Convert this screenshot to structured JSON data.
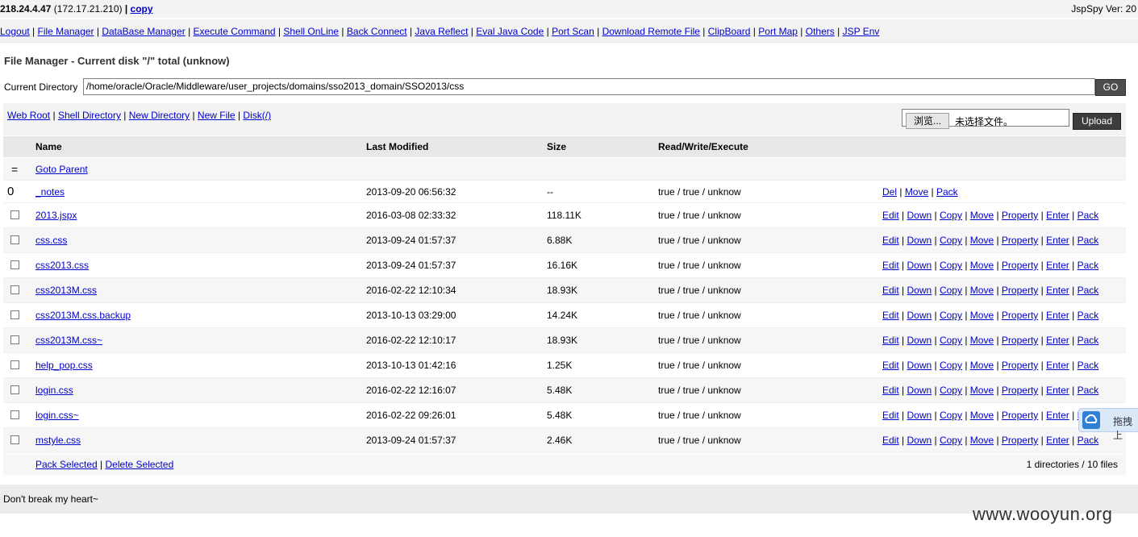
{
  "header": {
    "host": "218.24.4.47",
    "ip": "(172.17.21.210)",
    "copy_label": "copy",
    "version": "JspSpy Ver: 20"
  },
  "nav": [
    "Logout",
    "File Manager",
    "DataBase Manager",
    "Execute Command",
    "Shell OnLine",
    "Back Connect",
    "Java Reflect",
    "Eval Java Code",
    "Port Scan",
    "Download Remote File",
    "ClipBoard",
    "Port Map",
    "Others",
    "JSP Env"
  ],
  "title": "File Manager - Current disk \"/\" total (unknow)",
  "current_dir": {
    "label": "Current Directory",
    "value": "/home/oracle/Oracle/Middleware/user_projects/domains/sso2013_domain/SSO2013/css",
    "go": "GO"
  },
  "toolbar": {
    "links": [
      "Web Root",
      "Shell Directory",
      "New Directory",
      "New File",
      "Disk(/)"
    ],
    "browse": "浏览...",
    "no_file": "未选择文件。",
    "upload": "Upload"
  },
  "columns": {
    "name": "Name",
    "modified": "Last Modified",
    "size": "Size",
    "rwx": "Read/Write/Execute"
  },
  "parent": {
    "marker": "=",
    "label": "Goto Parent"
  },
  "dir_row": {
    "marker": "0",
    "name": "_notes",
    "modified": "2013-09-20 06:56:32",
    "size": "--",
    "rwx": "true / true / unknow",
    "actions": [
      "Del",
      "Move",
      "Pack"
    ]
  },
  "file_actions": [
    "Edit",
    "Down",
    "Copy",
    "Move",
    "Property",
    "Enter",
    "Pack"
  ],
  "files": [
    {
      "name": "2013.jspx",
      "modified": "2016-03-08 02:33:32",
      "size": "118.11K",
      "rwx": "true / true / unknow"
    },
    {
      "name": "css.css",
      "modified": "2013-09-24 01:57:37",
      "size": "6.88K",
      "rwx": "true / true / unknow"
    },
    {
      "name": "css2013.css",
      "modified": "2013-09-24 01:57:37",
      "size": "16.16K",
      "rwx": "true / true / unknow"
    },
    {
      "name": "css2013M.css",
      "modified": "2016-02-22 12:10:34",
      "size": "18.93K",
      "rwx": "true / true / unknow"
    },
    {
      "name": "css2013M.css.backup",
      "modified": "2013-10-13 03:29:00",
      "size": "14.24K",
      "rwx": "true / true / unknow"
    },
    {
      "name": "css2013M.css~",
      "modified": "2016-02-22 12:10:17",
      "size": "18.93K",
      "rwx": "true / true / unknow"
    },
    {
      "name": "help_pop.css",
      "modified": "2013-10-13 01:42:16",
      "size": "1.25K",
      "rwx": "true / true / unknow"
    },
    {
      "name": "login.css",
      "modified": "2016-02-22 12:16:07",
      "size": "5.48K",
      "rwx": "true / true / unknow"
    },
    {
      "name": "login.css~",
      "modified": "2016-02-22 09:26:01",
      "size": "5.48K",
      "rwx": "true / true / unknow"
    },
    {
      "name": "mstyle.css",
      "modified": "2013-09-24 01:57:37",
      "size": "2.46K",
      "rwx": "true / true / unknow"
    }
  ],
  "bottom": {
    "pack_selected": "Pack Selected",
    "delete_selected": "Delete Selected",
    "count": "1 directories / 10 files"
  },
  "footer": "Don't break my heart~",
  "float_widget": {
    "label": "拖拽上"
  },
  "watermark": "www.wooyun.org"
}
